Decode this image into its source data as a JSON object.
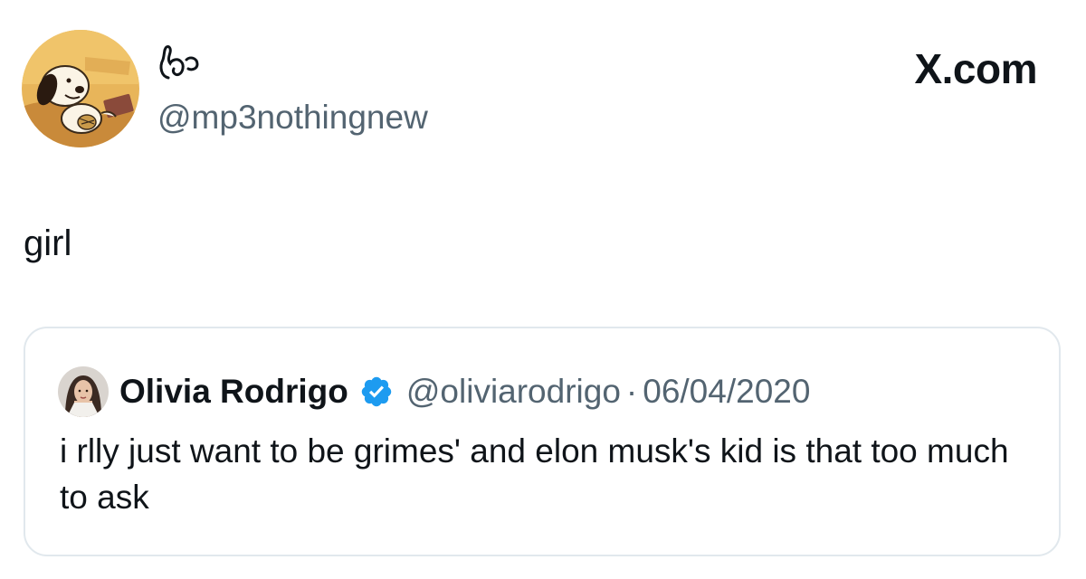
{
  "tweet": {
    "author": {
      "handle": "@mp3nothingnew",
      "avatar": "snoopy-avatar"
    },
    "brand": "X.com",
    "text": "girl",
    "quote": {
      "author_name": "Olivia Rodrigo",
      "verified": true,
      "handle": "@oliviarodrigo",
      "separator": "·",
      "date": "06/04/2020",
      "text": "i rlly just want to be grimes' and elon musk's kid is that too much to ask"
    }
  },
  "colors": {
    "text": "#0f1419",
    "secondary": "#536471",
    "border": "#e1e8ed",
    "verified": "#1d9bf0"
  }
}
